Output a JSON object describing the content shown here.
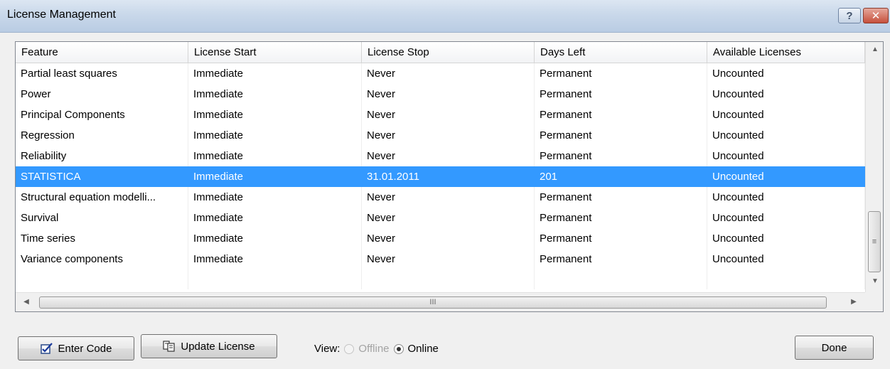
{
  "window": {
    "title": "License Management",
    "help_glyph": "?",
    "close_glyph": "✕"
  },
  "table": {
    "columns": [
      "Feature",
      "License Start",
      "License Stop",
      "Days Left",
      "Available Licenses"
    ],
    "rows": [
      [
        "Partial least squares",
        "Immediate",
        "Never",
        "Permanent",
        "Uncounted"
      ],
      [
        "Power",
        "Immediate",
        "Never",
        "Permanent",
        "Uncounted"
      ],
      [
        "Principal Components",
        "Immediate",
        "Never",
        "Permanent",
        "Uncounted"
      ],
      [
        "Regression",
        "Immediate",
        "Never",
        "Permanent",
        "Uncounted"
      ],
      [
        "Reliability",
        "Immediate",
        "Never",
        "Permanent",
        "Uncounted"
      ],
      [
        "STATISTICA",
        "Immediate",
        "31.01.2011",
        "201",
        "Uncounted"
      ],
      [
        "Structural equation modelli...",
        "Immediate",
        "Never",
        "Permanent",
        "Uncounted"
      ],
      [
        "Survival",
        "Immediate",
        "Never",
        "Permanent",
        "Uncounted"
      ],
      [
        "Time series",
        "Immediate",
        "Never",
        "Permanent",
        "Uncounted"
      ],
      [
        "Variance components",
        "Immediate",
        "Never",
        "Permanent",
        "Uncounted"
      ]
    ],
    "selected_index": 5
  },
  "buttons": {
    "enter_code": "Enter Code",
    "update_license": "Update License",
    "done": "Done"
  },
  "view": {
    "label": "View:",
    "options": [
      "Offline",
      "Online"
    ],
    "selected": "Online"
  },
  "icons": {
    "enter_code": "edit-check-icon",
    "update_license": "copy-documents-icon"
  },
  "colors": {
    "selection": "#3399ff",
    "titlebar": "#c9d8ea",
    "close": "#c6503c"
  }
}
